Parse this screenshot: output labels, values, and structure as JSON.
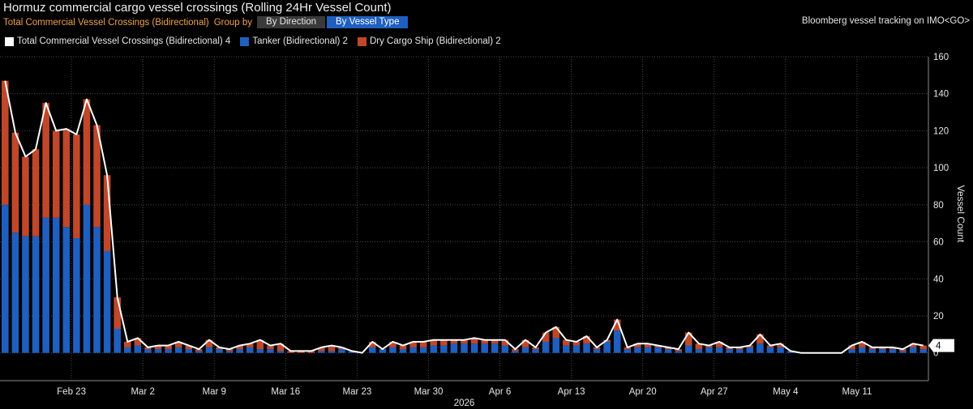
{
  "header": {
    "title": "Hormuz commercial cargo vessel crossings (Rolling 24Hr Vessel Count)",
    "metric": "Total Commercial Vessel Crossings (Bidirectional)",
    "group_by_label": "Group by",
    "group_options": [
      "By Direction",
      "By Vessel Type"
    ],
    "selected_group": "By Vessel Type",
    "source": "Bloomberg vessel tracking on IMO<GO>"
  },
  "colors": {
    "total": "#ffffff",
    "tanker": "#1f5fbf",
    "dry_cargo": "#c0472a",
    "grid": "#4a4a4a",
    "axis_text": "#e6e6e6",
    "background": "#000000"
  },
  "legend": [
    {
      "label": "Total Commercial Vessel Crossings (Bidirectional) 4",
      "color": "#ffffff"
    },
    {
      "label": "Tanker (Bidirectional) 2",
      "color": "#1f5fbf"
    },
    {
      "label": "Dry Cargo Ship (Bidirectional) 2",
      "color": "#c0472a"
    }
  ],
  "chart_data": {
    "type": "bar",
    "stacked": true,
    "title": "Hormuz commercial cargo vessel crossings (Rolling 24Hr Vessel Count)",
    "ylabel": "Vessel Count",
    "ylim": [
      -15,
      160
    ],
    "y_ticks": [
      0,
      20,
      40,
      60,
      80,
      100,
      120,
      140,
      160
    ],
    "y_axis_side": "right",
    "grid": true,
    "legend_position": "top-left",
    "x_tick_labels": [
      "Feb 23",
      "Mar 2",
      "Mar 9",
      "Mar 16",
      "Mar 23",
      "Mar 30",
      "Apr 6",
      "Apr 13",
      "Apr 20",
      "Apr 27",
      "May 4",
      "May 11"
    ],
    "x_year_label": "2026",
    "last_value_label": "4",
    "series": [
      {
        "name": "Tanker (Bidirectional)",
        "values": [
          80,
          65,
          63,
          63,
          73,
          73,
          68,
          62,
          80,
          68,
          55,
          13,
          3,
          4,
          2,
          2,
          2,
          3,
          2,
          1,
          3,
          2,
          1,
          2,
          3,
          2,
          2,
          1,
          0,
          0,
          0,
          1,
          1,
          2,
          1,
          0,
          3,
          2,
          3,
          2,
          3,
          3,
          4,
          4,
          5,
          5,
          5,
          5,
          5,
          4,
          1,
          3,
          2,
          6,
          8,
          4,
          4,
          5,
          2,
          6,
          12,
          2,
          3,
          3,
          3,
          2,
          1,
          4,
          2,
          3,
          3,
          2,
          2,
          3,
          5,
          3,
          3,
          1,
          0,
          0,
          0,
          0,
          0,
          2,
          3,
          2,
          2,
          2,
          1,
          3,
          2
        ]
      },
      {
        "name": "Dry Cargo Ship (Bidirectional)",
        "values": [
          67,
          54,
          43,
          47,
          62,
          47,
          53,
          56,
          57,
          55,
          41,
          17,
          3,
          4,
          1,
          2,
          2,
          3,
          2,
          1,
          4,
          1,
          1,
          2,
          2,
          5,
          2,
          4,
          1,
          1,
          1,
          2,
          3,
          1,
          0,
          0,
          3,
          0,
          3,
          2,
          3,
          3,
          3,
          3,
          2,
          2,
          3,
          2,
          2,
          3,
          1,
          4,
          1,
          5,
          6,
          3,
          2,
          4,
          1,
          1,
          6,
          1,
          2,
          2,
          1,
          1,
          1,
          7,
          3,
          1,
          3,
          1,
          1,
          1,
          5,
          1,
          2,
          0,
          0,
          0,
          0,
          0,
          0,
          2,
          3,
          1,
          1,
          1,
          1,
          2,
          2
        ]
      }
    ]
  }
}
